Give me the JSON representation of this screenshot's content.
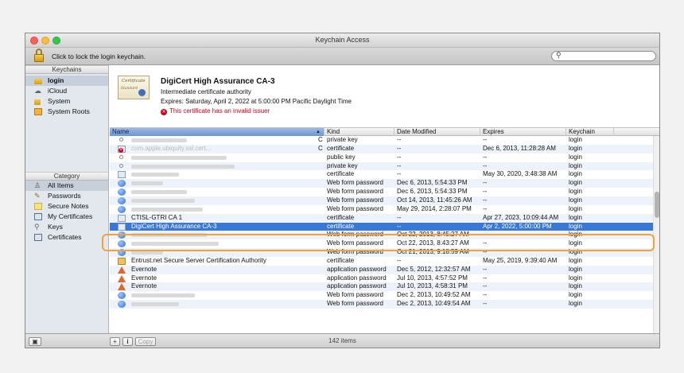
{
  "window": {
    "title": "Keychain Access"
  },
  "toolbar": {
    "lock_text": "Click to lock the login keychain.",
    "search_placeholder": ""
  },
  "sidebar": {
    "keychains_header": "Keychains",
    "keychains": [
      {
        "label": "login",
        "icon": "lock-open-icon",
        "selected": true
      },
      {
        "label": "iCloud",
        "icon": "cloud-icon"
      },
      {
        "label": "System",
        "icon": "lock-icon"
      },
      {
        "label": "System Roots",
        "icon": "folder-icon"
      }
    ],
    "category_header": "Category",
    "categories": [
      {
        "label": "All Items",
        "icon": "people-icon",
        "selected": true
      },
      {
        "label": "Passwords",
        "icon": "pen-icon"
      },
      {
        "label": "Secure Notes",
        "icon": "note-icon"
      },
      {
        "label": "My Certificates",
        "icon": "cert-icon"
      },
      {
        "label": "Keys",
        "icon": "key-icon"
      },
      {
        "label": "Certificates",
        "icon": "cert-icon"
      }
    ]
  },
  "preview": {
    "cert_image_text1": "Certificate",
    "cert_image_text2": "Standard",
    "title": "DigiCert High Assurance CA-3",
    "subtitle": "Intermediate certificate authority",
    "expires": "Expires: Saturday, April 2, 2022 at 5:00:00 PM Pacific Daylight Time",
    "error": "This certificate has an invalid issuer"
  },
  "columns": {
    "name": "Name",
    "kind": "Kind",
    "date_modified": "Date Modified",
    "expires": "Expires",
    "keychain": "Keychain"
  },
  "rows": [
    {
      "name": "",
      "icon": "key-icon",
      "kind": "private key",
      "modified": "--",
      "expires": "--",
      "keychain": "login",
      "tail": "C"
    },
    {
      "name": "com.apple.ubiquity.ssl.cert...",
      "icon": "cert-invalid-icon",
      "kind": "certificate",
      "modified": "--",
      "expires": "Dec 6, 2013, 11:28:28 AM",
      "keychain": "login",
      "tail": "C"
    },
    {
      "name": "",
      "icon": "key-icon",
      "kind": "public key",
      "modified": "--",
      "expires": "--",
      "keychain": "login"
    },
    {
      "name": "",
      "icon": "key-icon",
      "kind": "private key",
      "modified": "--",
      "expires": "--",
      "keychain": "login"
    },
    {
      "name": "",
      "icon": "cert-icon",
      "kind": "certificate",
      "modified": "--",
      "expires": "May 30, 2020, 3:48:38 AM",
      "keychain": "login"
    },
    {
      "name": "",
      "icon": "globe-icon",
      "kind": "Web form password",
      "modified": "Dec 6, 2013, 5:54:33 PM",
      "expires": "--",
      "keychain": "login"
    },
    {
      "name": "",
      "icon": "globe-icon",
      "kind": "Web form password",
      "modified": "Dec 6, 2013, 5:54:33 PM",
      "expires": "--",
      "keychain": "login"
    },
    {
      "name": "",
      "icon": "globe-icon",
      "kind": "Web form password",
      "modified": "Oct 14, 2013, 11:45:26 AM",
      "expires": "--",
      "keychain": "login"
    },
    {
      "name": "",
      "icon": "globe-icon",
      "kind": "Web form password",
      "modified": "May 29, 2014, 2:28:07 PM",
      "expires": "--",
      "keychain": "login"
    },
    {
      "name": "CTISL-GTRI CA 1",
      "icon": "cert-icon",
      "kind": "certificate",
      "modified": "--",
      "expires": "Apr 27, 2023, 10:09:44 AM",
      "keychain": "login"
    },
    {
      "name": "DigiCert High Assurance CA-3",
      "icon": "cert-icon",
      "kind": "certificate",
      "modified": "--",
      "expires": "Apr 2, 2022, 5:00:00 PM",
      "keychain": "login",
      "selected": true
    },
    {
      "name": "",
      "icon": "globe-icon",
      "kind": "Web form password",
      "modified": "Oct 22, 2013, 8:45:27 AM",
      "expires": "--",
      "keychain": "login"
    },
    {
      "name": "",
      "icon": "globe-icon",
      "kind": "Web form password",
      "modified": "Oct 22, 2013, 8:43:27 AM",
      "expires": "--",
      "keychain": "login"
    },
    {
      "name": "",
      "icon": "globe-icon",
      "kind": "Web form password",
      "modified": "Oct 21, 2013, 9:18:59 AM",
      "expires": "--",
      "keychain": "login"
    },
    {
      "name": "Entrust.net Secure Server Certification Authority",
      "icon": "cert-gold-icon",
      "kind": "certificate",
      "modified": "--",
      "expires": "May 25, 2019, 9:39:40 AM",
      "keychain": "login"
    },
    {
      "name": "Evernote",
      "icon": "app-icon",
      "kind": "application password",
      "modified": "Dec 5, 2012, 12:32:57 AM",
      "expires": "--",
      "keychain": "login"
    },
    {
      "name": "Evernote",
      "icon": "app-icon",
      "kind": "application password",
      "modified": "Jul 10, 2013, 4:57:52 PM",
      "expires": "--",
      "keychain": "login"
    },
    {
      "name": "Evernote",
      "icon": "app-icon",
      "kind": "application password",
      "modified": "Jul 10, 2013, 4:58:31 PM",
      "expires": "--",
      "keychain": "login"
    },
    {
      "name": "",
      "icon": "globe-icon",
      "kind": "Web form password",
      "modified": "Dec 2, 2013, 10:49:52 AM",
      "expires": "--",
      "keychain": "login"
    },
    {
      "name": "",
      "icon": "globe-icon",
      "kind": "Web form password",
      "modified": "Dec 2, 2013, 10:49:54 AM",
      "expires": "--",
      "keychain": "login"
    }
  ],
  "status": {
    "add_label": "+",
    "info_label": "i",
    "copy_label": "Copy",
    "count": "142 items"
  }
}
